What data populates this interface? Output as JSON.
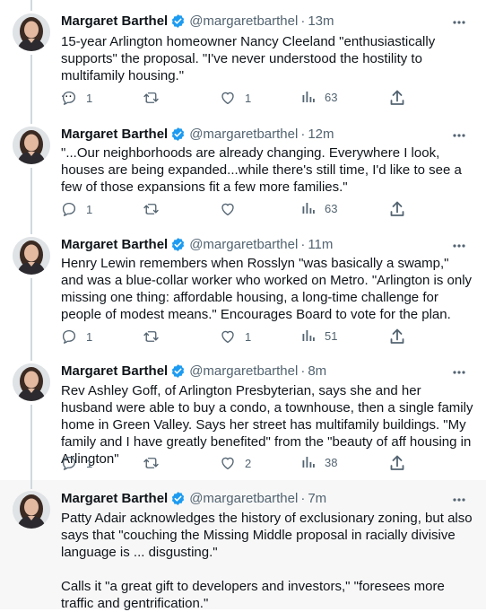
{
  "author": {
    "name": "Margaret Barthel",
    "handle": "@margaretbarthel",
    "separator": "·"
  },
  "colors": {
    "verified": "#1d9bf0",
    "thread_line": "#cfd9de",
    "secondary_text": "#536471",
    "highlight_bg": "#f7f7f7"
  },
  "tweets": [
    {
      "time": "13m",
      "text": "15-year Arlington homeowner Nancy Cleeland \"enthusiastically supports\" the proposal. \"I've never understood the hostility to multifamily housing.\"\n...",
      "replies": "1",
      "retweets": "",
      "likes": "1",
      "views": "63"
    },
    {
      "time": "12m",
      "text": "\"...Our neighborhoods are already changing. Everywhere I look, houses are being expanded...while there's still time, I'd like to see a few of those expansions fit a few more families.\"",
      "replies": "1",
      "retweets": "",
      "likes": "",
      "views": "63"
    },
    {
      "time": "11m",
      "text": "Henry Lewin remembers when Rosslyn \"was basically a swamp,\" and was a blue-collar worker who worked on Metro. \"Arlington is only missing one thing: affordable housing, a long-time challenge for people of modest means.\" Encourages Board to vote for the plan.",
      "replies": "1",
      "retweets": "",
      "likes": "1",
      "views": "51"
    },
    {
      "time": "8m",
      "text": "Rev Ashley Goff, of Arlington Presbyterian, says she and her husband were able to buy a condo, a townhouse, then a single family home in Green Valley. Says her street has multifamily buildings. \"My family and I have greatly benefited\" from the \"beauty of aff housing in Arlington\"",
      "replies": "1",
      "retweets": "",
      "likes": "2",
      "views": "38"
    },
    {
      "time": "7m",
      "text": "Patty Adair acknowledges the history of exclusionary zoning, but also says that \"couching the Missing Middle proposal in racially divisive language is ... disgusting.\"\n\nCalls it \"a great gift to developers and investors,\" \"foresees more traffic and gentrification.\""
    }
  ]
}
